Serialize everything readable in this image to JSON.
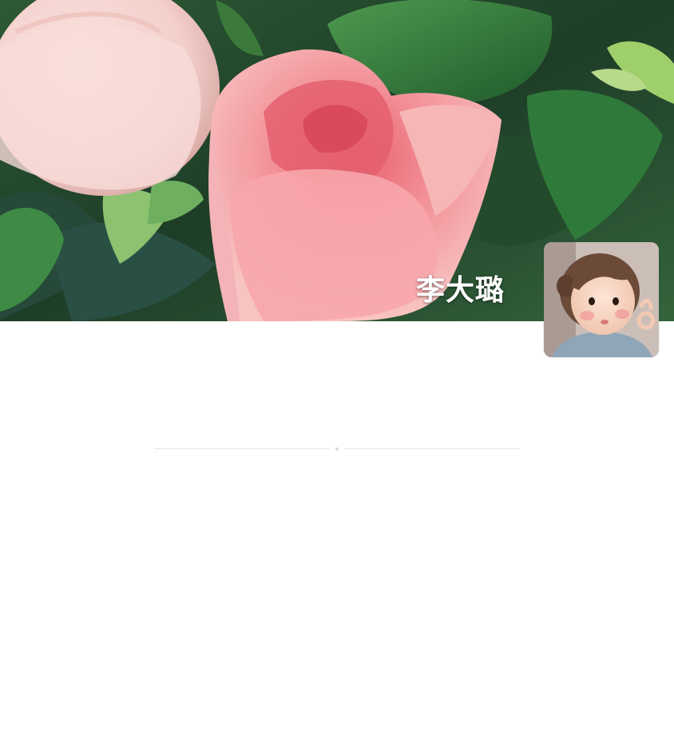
{
  "profile": {
    "name": "李大璐"
  },
  "cover": {
    "icon": "rose-photo",
    "colors": {
      "leaf": "#2f6b3a",
      "rose": "#f4a3a8",
      "rose_pale": "#f6d5d3"
    }
  },
  "avatar": {
    "icon": "child-photo-avatar"
  },
  "loading": {
    "icon": "loading-divider"
  }
}
